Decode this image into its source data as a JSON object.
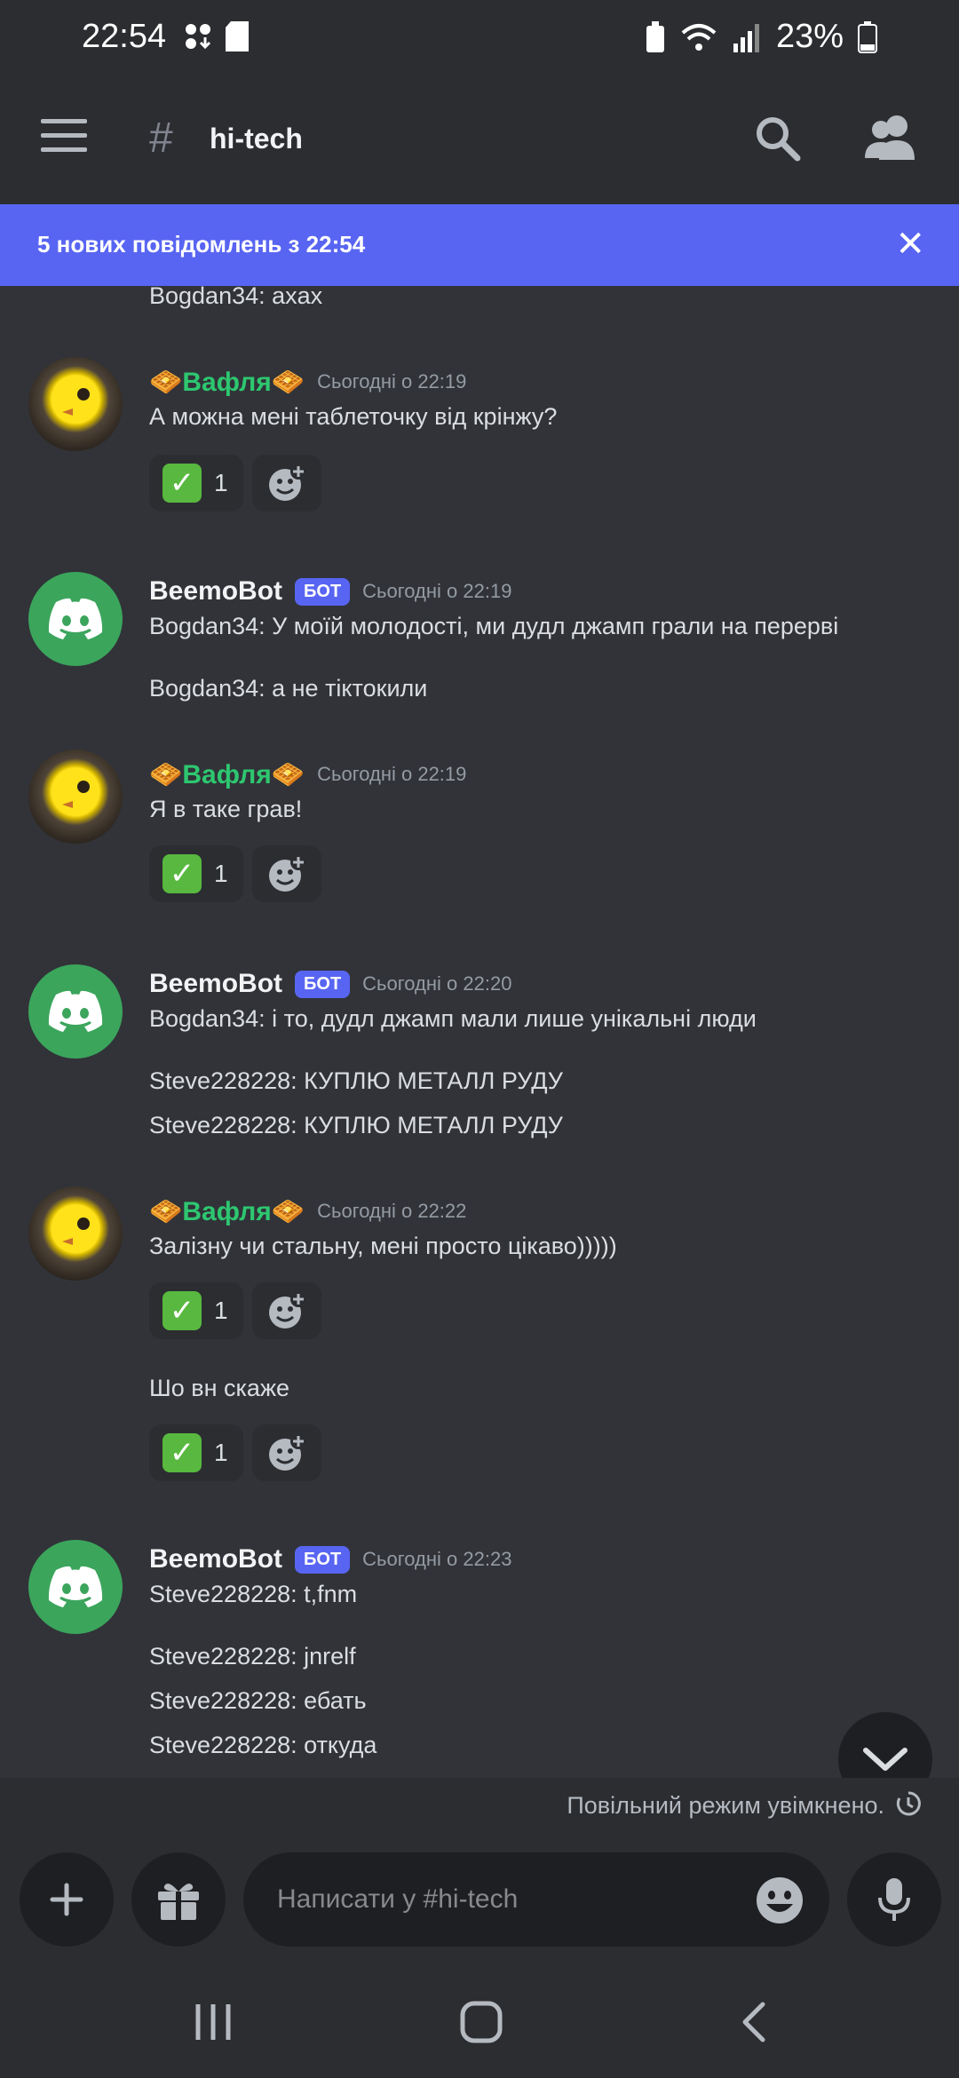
{
  "status_bar": {
    "time": "22:54",
    "battery": "23%"
  },
  "app_bar": {
    "channel": "hi-tech"
  },
  "new_messages_banner": {
    "text": "5 нових повідомлень з 22:54",
    "close": "✕"
  },
  "messages": {
    "top_fragment": "Bogdan34: axax",
    "g1": {
      "author": "🧇Вафля🧇",
      "time": "Сьогодні о 22:19",
      "text": "А можна мені таблеточку від крінжу?",
      "reaction_count": "1"
    },
    "g2": {
      "author": "BeemoBot",
      "bot_tag": "БОТ",
      "time": "Сьогодні о 22:19",
      "lines": [
        "Bogdan34: У моїй молодості, ми дудл джамп грали на перерві",
        "Bogdan34: а не тіктокили"
      ]
    },
    "g3": {
      "author": "🧇Вафля🧇",
      "time": "Сьогодні о 22:19",
      "text": "Я в таке грав!",
      "reaction_count": "1"
    },
    "g4": {
      "author": "BeemoBot",
      "bot_tag": "БОТ",
      "time": "Сьогодні о 22:20",
      "lines": [
        "Bogdan34: і то, дудл джамп мали лише унікальні люди",
        "Steve228228: КУПЛЮ МЕТАЛЛ РУДУ",
        "Steve228228: КУПЛЮ МЕТАЛЛ РУДУ"
      ]
    },
    "g5": {
      "author": "🧇Вафля🧇",
      "time": "Сьогодні о 22:22",
      "text": "Залізну чи стальну, мені просто цікаво)))))",
      "reaction_count": "1",
      "text2": "Шо вн скаже",
      "reaction_count2": "1"
    },
    "g6": {
      "author": "BeemoBot",
      "bot_tag": "БОТ",
      "time": "Сьогодні о 22:23",
      "lines": [
        "Steve228228: t,fnm",
        "Steve228228: jnrelf",
        "Steve228228: ебать",
        "Steve228228: откуда"
      ]
    }
  },
  "slowmode": {
    "text": "Повільний режим увімкнено."
  },
  "composer": {
    "placeholder": "Написати у #hi-tech"
  },
  "colors": {
    "accent": "#5865f2",
    "bot_avatar": "#3ba55c",
    "username_green": "#2dc770",
    "background": "#313338"
  },
  "icons": [
    "menu-icon",
    "hash-icon",
    "search-icon",
    "members-icon",
    "close-icon",
    "discord-logo-icon",
    "check-mark-emoji-icon",
    "add-reaction-icon",
    "chevron-down-icon",
    "slowmode-clock-icon",
    "plus-icon",
    "gift-icon",
    "emoji-icon",
    "microphone-icon"
  ]
}
